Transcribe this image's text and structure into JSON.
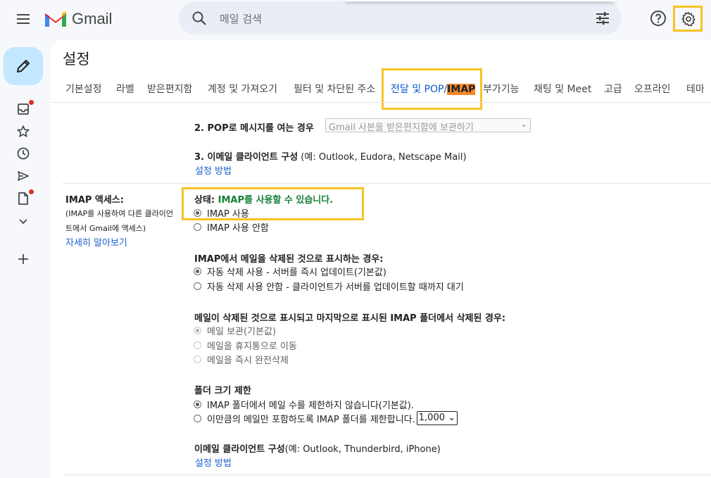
{
  "app": {
    "name": "Gmail"
  },
  "search": {
    "placeholder": "메일 검색"
  },
  "icons": {
    "menu": "menu-icon",
    "search": "search-icon",
    "tune": "tune-icon",
    "help": "help-icon",
    "settings": "gear-icon",
    "compose": "pencil-icon",
    "inbox": "inbox-icon",
    "starred": "star-icon",
    "snoozed": "clock-icon",
    "sent": "send-icon",
    "drafts": "draft-icon",
    "more": "chevron-down-icon",
    "add": "plus-icon"
  },
  "colors": {
    "accent": "#0b57d0",
    "highlight_box": "#f7c325",
    "status_green": "#188038",
    "unread_dot": "#d93025",
    "compose_bg": "#c2e7ff"
  },
  "page_title": "설정",
  "tabs": [
    {
      "label": "기본설정"
    },
    {
      "label": "라벨"
    },
    {
      "label": "받은편지함"
    },
    {
      "label": "계정 및 가져오기"
    },
    {
      "label": "필터 및 차단된 주소"
    },
    {
      "label_prefix": "전달 및 POP/",
      "label_highlight": "IMAP",
      "active": true
    },
    {
      "label": "부가기능"
    },
    {
      "label": "채팅 및 Meet"
    },
    {
      "label": "고급"
    },
    {
      "label": "오프라인"
    },
    {
      "label": "테마"
    }
  ],
  "pop": {
    "step2_label": "2. POP로 메시지를 여는 경우",
    "step2_select": "Gmail 사본을 받은편지함에 보관하기",
    "step3_label": "3. 이메일 클라이언트 구성",
    "step3_note": " (예: Outlook, Eudora, Netscape Mail)",
    "setup_link": "설정 방법"
  },
  "imap": {
    "section_title": "IMAP 액세스:",
    "note_line1": "(IMAP를 사용하여 다른 클라이언",
    "note_line2": "트에서 Gmail에 액세스)",
    "learn_more": "자세히 알아보기",
    "status_label": "상태: ",
    "status_value": "IMAP를 사용할 수 있습니다.",
    "enable": [
      {
        "label": "IMAP 사용",
        "checked": true
      },
      {
        "label": "IMAP 사용 안함",
        "checked": false
      }
    ],
    "delete_mark_title": "IMAP에서 메일을 삭제된 것으로 표시하는 경우:",
    "delete_mark_options": [
      {
        "label": "자동 삭제 사용 - 서버를 즉시 업데이트(기본값)",
        "checked": true
      },
      {
        "label": "자동 삭제 사용 안함 - 클라이언트가 서버를 업데이트할 때까지 대기",
        "checked": false
      }
    ],
    "expunge_title": "메일이 삭제된 것으로 표시되고 마지막으로 표시된 IMAP 폴더에서 삭제된 경우:",
    "expunge_options": [
      {
        "label": "메일 보관(기본값)",
        "checked": true
      },
      {
        "label": "메일을 휴지통으로 이동",
        "checked": false
      },
      {
        "label": "메일을 즉시 완전삭제",
        "checked": false
      }
    ],
    "folder_limit_title": "폴더 크기 제한",
    "folder_limit_options": [
      {
        "label": "IMAP 폴더에서 메일 수를 제한하지 않습니다(기본값).",
        "checked": true
      },
      {
        "label": "이만큼의 메일만 포함하도록 IMAP 폴더를 제한합니다.",
        "checked": false
      }
    ],
    "folder_limit_count": "1,000",
    "client_config_title": "이메일 클라이언트 구성",
    "client_config_note": "(예: Outlook, Thunderbird, iPhone)",
    "client_setup_link": "설정 방법"
  }
}
